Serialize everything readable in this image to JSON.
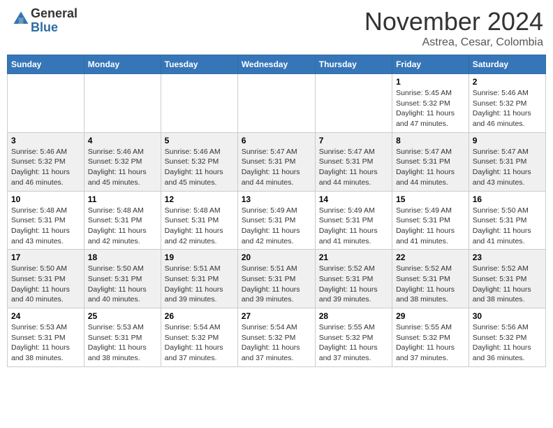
{
  "header": {
    "logo_line1": "General",
    "logo_line2": "Blue",
    "month": "November 2024",
    "location": "Astrea, Cesar, Colombia"
  },
  "weekdays": [
    "Sunday",
    "Monday",
    "Tuesday",
    "Wednesday",
    "Thursday",
    "Friday",
    "Saturday"
  ],
  "weeks": [
    [
      {
        "day": "",
        "info": ""
      },
      {
        "day": "",
        "info": ""
      },
      {
        "day": "",
        "info": ""
      },
      {
        "day": "",
        "info": ""
      },
      {
        "day": "",
        "info": ""
      },
      {
        "day": "1",
        "info": "Sunrise: 5:45 AM\nSunset: 5:32 PM\nDaylight: 11 hours\nand 47 minutes."
      },
      {
        "day": "2",
        "info": "Sunrise: 5:46 AM\nSunset: 5:32 PM\nDaylight: 11 hours\nand 46 minutes."
      }
    ],
    [
      {
        "day": "3",
        "info": "Sunrise: 5:46 AM\nSunset: 5:32 PM\nDaylight: 11 hours\nand 46 minutes."
      },
      {
        "day": "4",
        "info": "Sunrise: 5:46 AM\nSunset: 5:32 PM\nDaylight: 11 hours\nand 45 minutes."
      },
      {
        "day": "5",
        "info": "Sunrise: 5:46 AM\nSunset: 5:32 PM\nDaylight: 11 hours\nand 45 minutes."
      },
      {
        "day": "6",
        "info": "Sunrise: 5:47 AM\nSunset: 5:31 PM\nDaylight: 11 hours\nand 44 minutes."
      },
      {
        "day": "7",
        "info": "Sunrise: 5:47 AM\nSunset: 5:31 PM\nDaylight: 11 hours\nand 44 minutes."
      },
      {
        "day": "8",
        "info": "Sunrise: 5:47 AM\nSunset: 5:31 PM\nDaylight: 11 hours\nand 44 minutes."
      },
      {
        "day": "9",
        "info": "Sunrise: 5:47 AM\nSunset: 5:31 PM\nDaylight: 11 hours\nand 43 minutes."
      }
    ],
    [
      {
        "day": "10",
        "info": "Sunrise: 5:48 AM\nSunset: 5:31 PM\nDaylight: 11 hours\nand 43 minutes."
      },
      {
        "day": "11",
        "info": "Sunrise: 5:48 AM\nSunset: 5:31 PM\nDaylight: 11 hours\nand 42 minutes."
      },
      {
        "day": "12",
        "info": "Sunrise: 5:48 AM\nSunset: 5:31 PM\nDaylight: 11 hours\nand 42 minutes."
      },
      {
        "day": "13",
        "info": "Sunrise: 5:49 AM\nSunset: 5:31 PM\nDaylight: 11 hours\nand 42 minutes."
      },
      {
        "day": "14",
        "info": "Sunrise: 5:49 AM\nSunset: 5:31 PM\nDaylight: 11 hours\nand 41 minutes."
      },
      {
        "day": "15",
        "info": "Sunrise: 5:49 AM\nSunset: 5:31 PM\nDaylight: 11 hours\nand 41 minutes."
      },
      {
        "day": "16",
        "info": "Sunrise: 5:50 AM\nSunset: 5:31 PM\nDaylight: 11 hours\nand 41 minutes."
      }
    ],
    [
      {
        "day": "17",
        "info": "Sunrise: 5:50 AM\nSunset: 5:31 PM\nDaylight: 11 hours\nand 40 minutes."
      },
      {
        "day": "18",
        "info": "Sunrise: 5:50 AM\nSunset: 5:31 PM\nDaylight: 11 hours\nand 40 minutes."
      },
      {
        "day": "19",
        "info": "Sunrise: 5:51 AM\nSunset: 5:31 PM\nDaylight: 11 hours\nand 39 minutes."
      },
      {
        "day": "20",
        "info": "Sunrise: 5:51 AM\nSunset: 5:31 PM\nDaylight: 11 hours\nand 39 minutes."
      },
      {
        "day": "21",
        "info": "Sunrise: 5:52 AM\nSunset: 5:31 PM\nDaylight: 11 hours\nand 39 minutes."
      },
      {
        "day": "22",
        "info": "Sunrise: 5:52 AM\nSunset: 5:31 PM\nDaylight: 11 hours\nand 38 minutes."
      },
      {
        "day": "23",
        "info": "Sunrise: 5:52 AM\nSunset: 5:31 PM\nDaylight: 11 hours\nand 38 minutes."
      }
    ],
    [
      {
        "day": "24",
        "info": "Sunrise: 5:53 AM\nSunset: 5:31 PM\nDaylight: 11 hours\nand 38 minutes."
      },
      {
        "day": "25",
        "info": "Sunrise: 5:53 AM\nSunset: 5:31 PM\nDaylight: 11 hours\nand 38 minutes."
      },
      {
        "day": "26",
        "info": "Sunrise: 5:54 AM\nSunset: 5:32 PM\nDaylight: 11 hours\nand 37 minutes."
      },
      {
        "day": "27",
        "info": "Sunrise: 5:54 AM\nSunset: 5:32 PM\nDaylight: 11 hours\nand 37 minutes."
      },
      {
        "day": "28",
        "info": "Sunrise: 5:55 AM\nSunset: 5:32 PM\nDaylight: 11 hours\nand 37 minutes."
      },
      {
        "day": "29",
        "info": "Sunrise: 5:55 AM\nSunset: 5:32 PM\nDaylight: 11 hours\nand 37 minutes."
      },
      {
        "day": "30",
        "info": "Sunrise: 5:56 AM\nSunset: 5:32 PM\nDaylight: 11 hours\nand 36 minutes."
      }
    ]
  ]
}
